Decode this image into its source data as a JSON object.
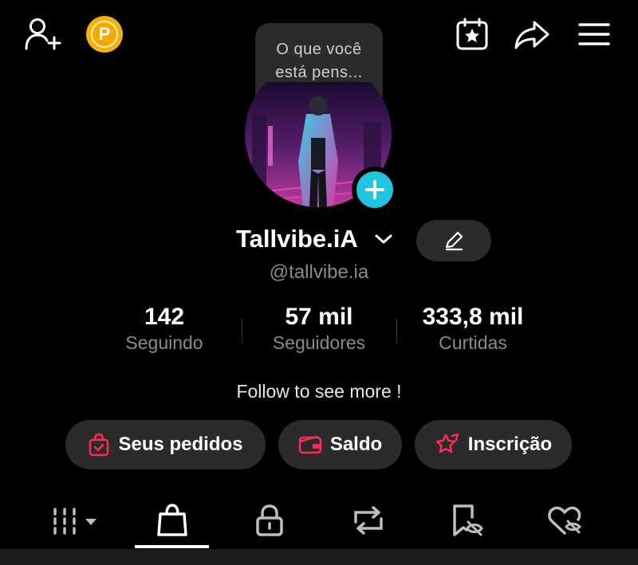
{
  "header": {
    "draft_bubble_line1": "O que você",
    "draft_bubble_line2": "está pens..."
  },
  "coin_letter": "P",
  "profile": {
    "display_name": "Tallvibe.iA",
    "handle": "@tallvibe.ia",
    "bio": "Follow to see more !"
  },
  "stats": [
    {
      "value": "142",
      "label": "Seguindo"
    },
    {
      "value": "57 mil",
      "label": "Seguidores"
    },
    {
      "value": "333,8 mil",
      "label": "Curtidas"
    }
  ],
  "actions": {
    "orders_label": "Seus pedidos",
    "balance_label": "Saldo",
    "subscription_label": "Inscrição"
  },
  "tabs": [
    {
      "icon": "grid-icon",
      "selected": false
    },
    {
      "icon": "shopping-bag-icon",
      "selected": true
    },
    {
      "icon": "lock-icon",
      "selected": false
    },
    {
      "icon": "repost-icon",
      "selected": false
    },
    {
      "icon": "hidden-bookmark-icon",
      "selected": false
    },
    {
      "icon": "hidden-heart-icon",
      "selected": false
    }
  ],
  "colors": {
    "background": "#000000",
    "surface": "#2b2b2b",
    "accent_cyan": "#1fc4e0",
    "accent_red": "#fe2c55",
    "coin_gold": "#f5b10a",
    "muted_text": "#8a8a8a"
  }
}
